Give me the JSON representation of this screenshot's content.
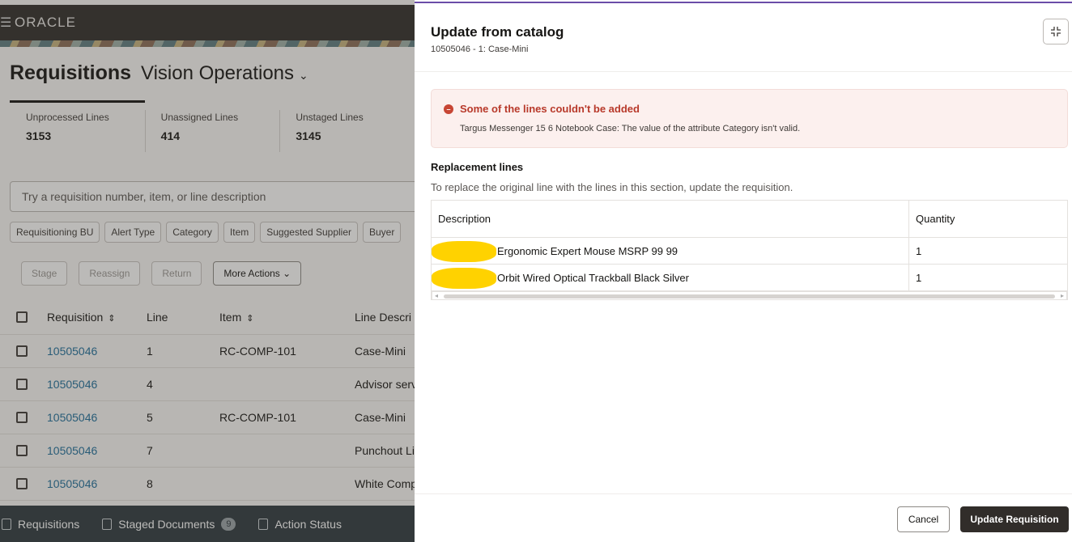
{
  "app": {
    "logo": "ORACLE",
    "menu_icon": "hamburger-icon"
  },
  "page": {
    "title": "Requisitions",
    "business_unit": "Vision Operations",
    "bu_chevron": "⌄"
  },
  "metrics": [
    {
      "label": "Unprocessed Lines",
      "value": "3153"
    },
    {
      "label": "Unassigned Lines",
      "value": "414"
    },
    {
      "label": "Unstaged Lines",
      "value": "3145"
    }
  ],
  "search": {
    "placeholder": "Try a requisition number, item, or line description"
  },
  "filters": [
    "Requisitioning BU",
    "Alert Type",
    "Category",
    "Item",
    "Suggested Supplier",
    "Buyer"
  ],
  "toolbar": {
    "stage": "Stage",
    "reassign": "Reassign",
    "return": "Return",
    "more_actions": "More Actions"
  },
  "table": {
    "headers": {
      "requisition": "Requisition",
      "line": "Line",
      "item": "Item",
      "line_description": "Line Descri"
    },
    "rows": [
      {
        "requisition": "10505046",
        "line": "1",
        "item": "RC-COMP-101",
        "description": "Case-Mini"
      },
      {
        "requisition": "10505046",
        "line": "4",
        "item": "",
        "description": "Advisor serv"
      },
      {
        "requisition": "10505046",
        "line": "5",
        "item": "RC-COMP-101",
        "description": "Case-Mini"
      },
      {
        "requisition": "10505046",
        "line": "7",
        "item": "",
        "description": "Punchout Li"
      },
      {
        "requisition": "10505046",
        "line": "8",
        "item": "",
        "description": "White Comp"
      }
    ]
  },
  "bottom_nav": {
    "requisitions": "Requisitions",
    "staged_documents": "Staged Documents",
    "staged_count": "9",
    "action_status": "Action Status"
  },
  "drawer": {
    "title": "Update from catalog",
    "subtitle": "10505046 - 1: Case-Mini",
    "error": {
      "title": "Some of the lines couldn't be added",
      "message": "Targus Messenger 15 6 Notebook Case: The value of the attribute Category isn't valid."
    },
    "section_title": "Replacement lines",
    "section_description": "To replace the original line with the lines in this section, update the requisition.",
    "columns": {
      "description": "Description",
      "quantity": "Quantity"
    },
    "lines": [
      {
        "description": "Ergonomic Expert Mouse MSRP 99 99",
        "quantity": "1"
      },
      {
        "description": "Orbit Wired Optical Trackball Black Silver",
        "quantity": "1"
      }
    ],
    "cancel": "Cancel",
    "update": "Update Requisition"
  },
  "colors": {
    "accent_dark": "#312d2a",
    "error": "#b8392a",
    "link": "#1f6f9c",
    "redaction": "#ffd200"
  }
}
